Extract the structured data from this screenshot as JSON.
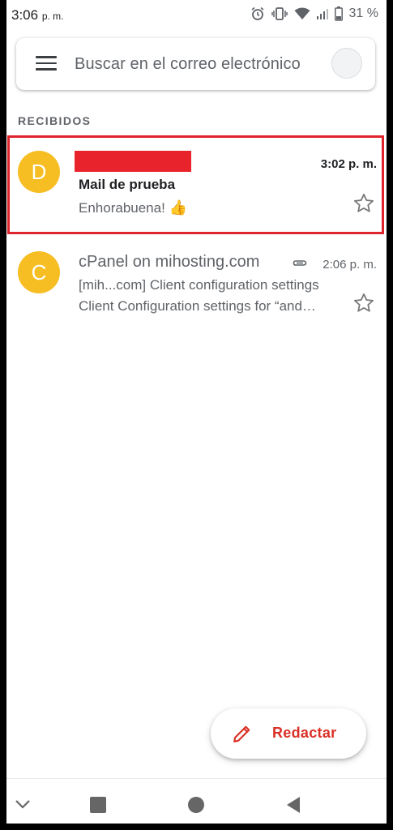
{
  "status_bar": {
    "time": "3:06",
    "time_suffix": "p. m.",
    "battery": "31 %"
  },
  "search": {
    "placeholder": "Buscar en el correo electrónico"
  },
  "section": {
    "label": "RECIBIDOS"
  },
  "emails": [
    {
      "avatar_letter": "D",
      "sender": "",
      "time": "3:02 p. m.",
      "subject": "Mail de prueba",
      "snippet": "Enhorabuena! ",
      "snippet_emoji": "👍",
      "unread": true,
      "highlighted": true
    },
    {
      "avatar_letter": "C",
      "sender": "cPanel on mihosting.com",
      "time": "2:06 p. m.",
      "subject": "[mih...com] Client configuration settings",
      "snippet": "Client Configuration settings for “and…",
      "has_attachment": true,
      "unread": false
    }
  ],
  "compose": {
    "label": "Redactar"
  },
  "colors": {
    "avatar": "#f6be22",
    "highlight_border": "#e0242b",
    "compose_accent": "#d93025"
  }
}
